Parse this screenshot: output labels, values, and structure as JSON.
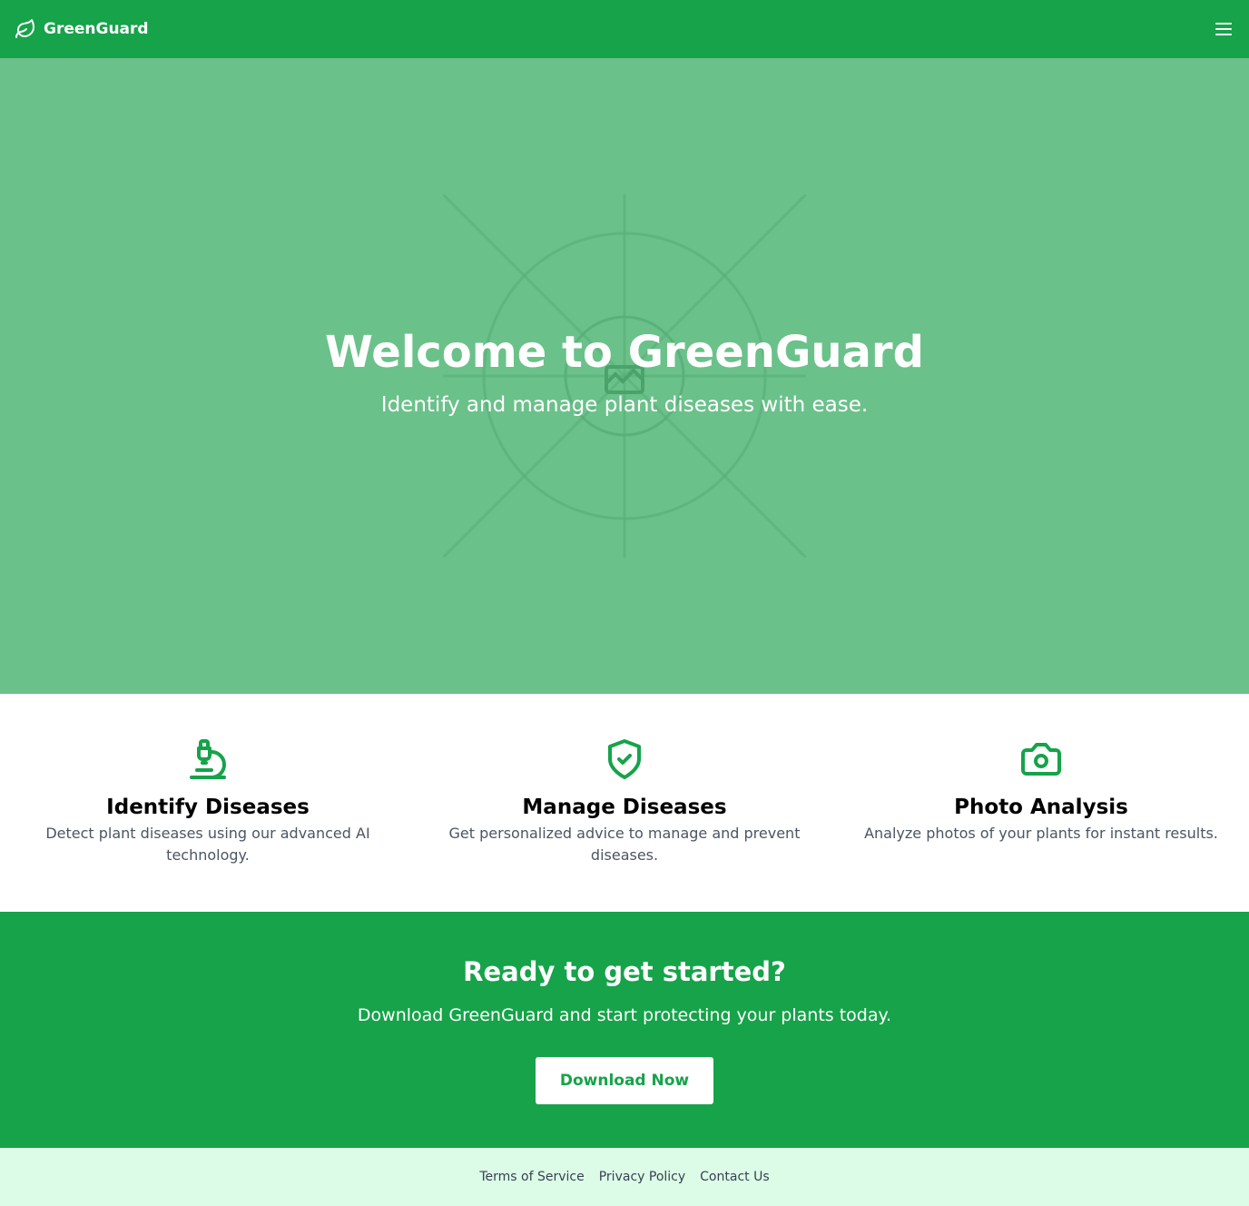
{
  "header": {
    "brand_name": "GreenGuard",
    "brand_icon": "leaf-icon",
    "menu_icon": "hamburger-menu-icon"
  },
  "hero": {
    "title": "Welcome to GreenGuard",
    "subtitle": "Identify and manage plant diseases with ease.",
    "background_icon": "image-placeholder-icon"
  },
  "features": [
    {
      "icon": "microscope-icon",
      "title": "Identify Diseases",
      "text": "Detect plant diseases using our advanced AI technology."
    },
    {
      "icon": "shield-check-icon",
      "title": "Manage Diseases",
      "text": "Get personalized advice to manage and prevent diseases."
    },
    {
      "icon": "camera-icon",
      "title": "Photo Analysis",
      "text": "Analyze photos of your plants for instant results."
    }
  ],
  "cta": {
    "title": "Ready to get started?",
    "text": "Download GreenGuard and start protecting your plants today.",
    "button_label": "Download Now"
  },
  "footer": {
    "links": [
      "Terms of Service",
      "Privacy Policy",
      "Contact Us"
    ]
  },
  "colors": {
    "primary": "#16a34a",
    "hero_bg": "#6bc18a",
    "footer_bg": "#dcfce7",
    "muted_text": "#4b5563"
  }
}
